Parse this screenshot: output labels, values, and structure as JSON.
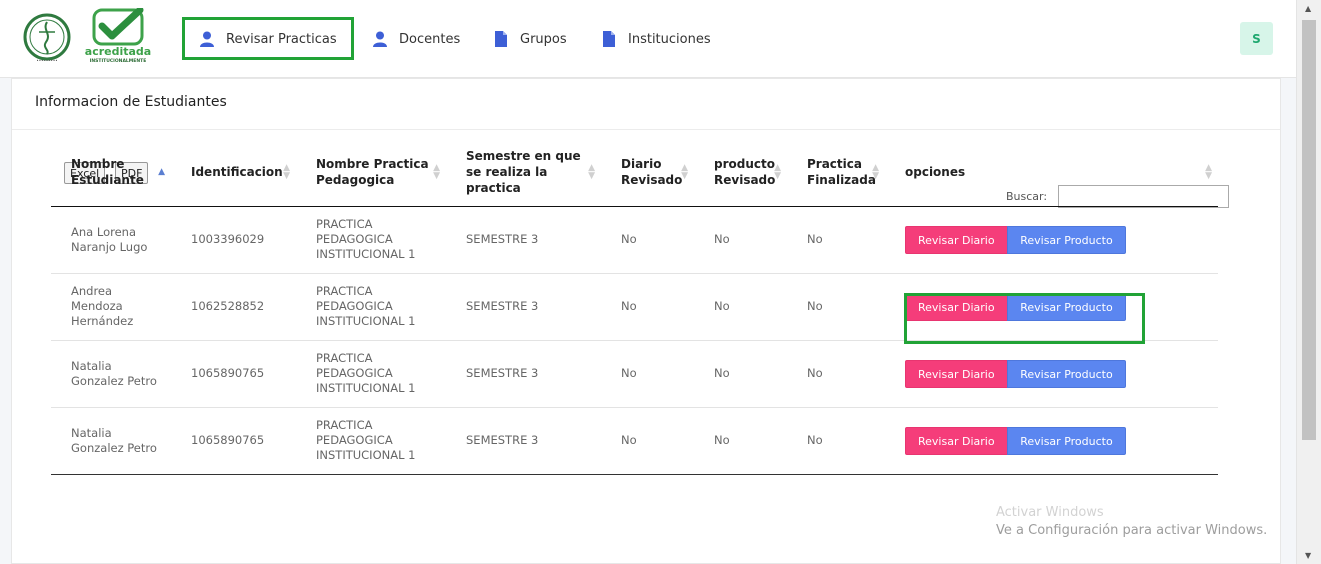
{
  "nav": {
    "items": [
      {
        "label": "Revisar Practicas",
        "icon": "user-icon"
      },
      {
        "label": "Docentes",
        "icon": "user-icon"
      },
      {
        "label": "Grupos",
        "icon": "file-icon"
      },
      {
        "label": "Instituciones",
        "icon": "file-icon"
      }
    ],
    "avatar": "S",
    "logo_text": "acreditada",
    "logo_subtext": "INSTITUCIONALMENTE"
  },
  "page": {
    "title": "Informacion de Estudiantes",
    "excel_label": "Excel",
    "pdf_label": "PDF",
    "search_label": "Buscar:",
    "search_value": ""
  },
  "table": {
    "headers": [
      "Nombre Estudiante",
      "Identificacion",
      "Nombre Practica Pedagogica",
      "Semestre en que se realiza la practica",
      "Diario Revisado",
      "producto Revisado",
      "Practica Finalizada",
      "opciones"
    ],
    "rows": [
      {
        "nombre": "Ana Lorena Naranjo Lugo",
        "id": "1003396029",
        "practica": "PRACTICA PEDAGOGICA INSTITUCIONAL 1",
        "semestre": "SEMESTRE 3",
        "diario": "No",
        "producto": "No",
        "finalizada": "No"
      },
      {
        "nombre": "Andrea Mendoza Hernández",
        "id": "1062528852",
        "practica": "PRACTICA PEDAGOGICA INSTITUCIONAL 1",
        "semestre": "SEMESTRE 3",
        "diario": "No",
        "producto": "No",
        "finalizada": "No"
      },
      {
        "nombre": "Natalia Gonzalez Petro",
        "id": "1065890765",
        "practica": "PRACTICA PEDAGOGICA INSTITUCIONAL 1",
        "semestre": "SEMESTRE 3",
        "diario": "No",
        "producto": "No",
        "finalizada": "No"
      },
      {
        "nombre": "Natalia Gonzalez Petro",
        "id": "1065890765",
        "practica": "PRACTICA PEDAGOGICA INSTITUCIONAL 1",
        "semestre": "SEMESTRE 3",
        "diario": "No",
        "producto": "No",
        "finalizada": "No"
      }
    ],
    "btn_diario": "Revisar Diario",
    "btn_producto": "Revisar Producto"
  },
  "watermark": {
    "line1": "Activar Windows",
    "line2": "Ve a Configuración para activar Windows."
  },
  "colors": {
    "highlight": "#21a336",
    "diario_btn": "#f53d7a",
    "producto_btn": "#5b86f0",
    "nav_icon": "#3d5fd6"
  }
}
